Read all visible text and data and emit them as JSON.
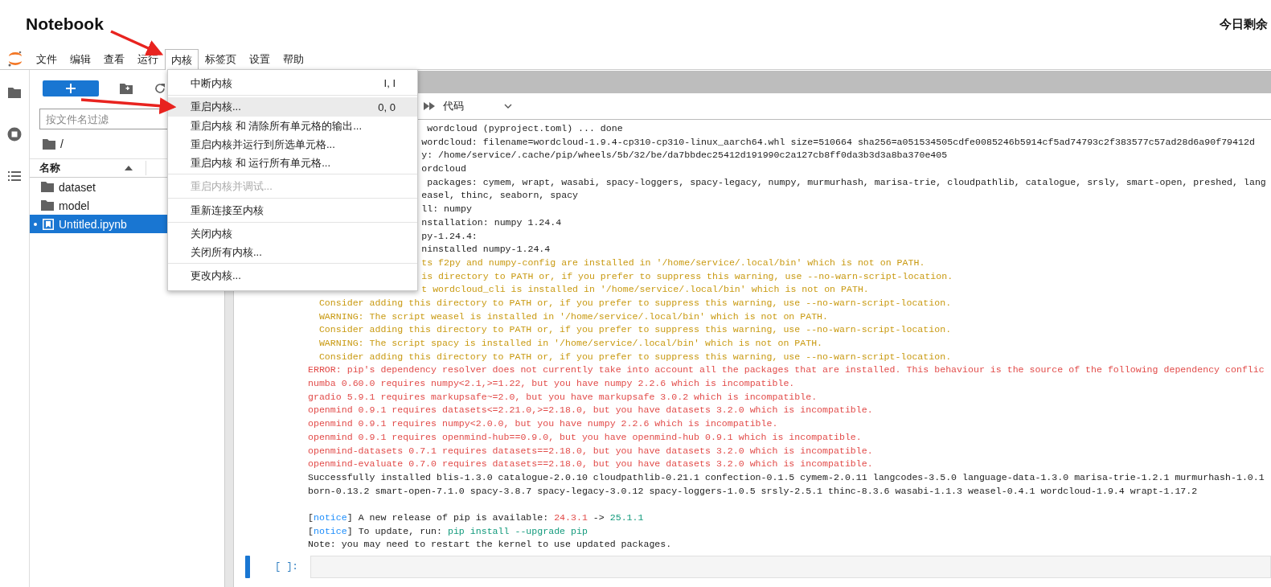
{
  "header": {
    "title": "Notebook",
    "quota_text": "今日剩余"
  },
  "menubar": {
    "items": [
      {
        "label": "文件",
        "selected": false
      },
      {
        "label": "编辑",
        "selected": false
      },
      {
        "label": "查看",
        "selected": false
      },
      {
        "label": "运行",
        "selected": false
      },
      {
        "label": "内核",
        "selected": true
      },
      {
        "label": "标签页",
        "selected": false
      },
      {
        "label": "设置",
        "selected": false
      },
      {
        "label": "帮助",
        "selected": false
      }
    ]
  },
  "kernel_menu": {
    "groups": [
      [
        {
          "label": "中断内核",
          "shortcut": "I, I",
          "highlighted": false,
          "disabled": false
        }
      ],
      [
        {
          "label": "重启内核...",
          "shortcut": "0, 0",
          "highlighted": true,
          "disabled": false
        },
        {
          "label": "重启内核 和 清除所有单元格的输出...",
          "highlighted": false,
          "disabled": false
        },
        {
          "label": "重启内核并运行到所选单元格...",
          "highlighted": false,
          "disabled": false
        },
        {
          "label": "重启内核 和 运行所有单元格...",
          "highlighted": false,
          "disabled": false
        }
      ],
      [
        {
          "label": "重启内核并调试...",
          "highlighted": false,
          "disabled": true
        }
      ],
      [
        {
          "label": "重新连接至内核",
          "highlighted": false,
          "disabled": false
        }
      ],
      [
        {
          "label": "关闭内核",
          "highlighted": false,
          "disabled": false
        },
        {
          "label": "关闭所有内核...",
          "highlighted": false,
          "disabled": false
        }
      ],
      [
        {
          "label": "更改内核...",
          "highlighted": false,
          "disabled": false
        }
      ]
    ]
  },
  "file_browser": {
    "filter_placeholder": "按文件名过滤",
    "path": "/",
    "column": "名称",
    "files": [
      {
        "name": "dataset",
        "kind": "folder",
        "selected": false,
        "running": false
      },
      {
        "name": "model",
        "kind": "folder",
        "selected": false,
        "running": false
      },
      {
        "name": "Untitled.ipynb",
        "kind": "notebook",
        "selected": true,
        "running": true
      }
    ]
  },
  "notebook": {
    "cell_type": "代码",
    "prompt": "[ ]:",
    "output": [
      {
        "kind": "plain",
        "covered": true,
        "text": " wordcloud (pyproject.toml) ... done"
      },
      {
        "kind": "plain",
        "covered": true,
        "text": "wordcloud: filename=wordcloud-1.9.4-cp310-cp310-linux_aarch64.whl size=510664 sha256=a051534505cdfe0085246b5914cf5ad74793c2f383577c57ad28d6a90f79412d"
      },
      {
        "kind": "plain",
        "covered": true,
        "text": "y: /home/service/.cache/pip/wheels/5b/32/be/da7bbdec25412d191990c2a127cb8ff0da3b3d3a8ba370e405"
      },
      {
        "kind": "plain",
        "covered": true,
        "text": "ordcloud"
      },
      {
        "kind": "plain",
        "covered": true,
        "text": " packages: cymem, wrapt, wasabi, spacy-loggers, spacy-legacy, numpy, murmurhash, marisa-trie, cloudpathlib, catalogue, srsly, smart-open, preshed, lang"
      },
      {
        "kind": "plain",
        "covered": true,
        "text": "easel, thinc, seaborn, spacy"
      },
      {
        "kind": "plain",
        "covered": true,
        "text": "ll: numpy"
      },
      {
        "kind": "plain",
        "covered": true,
        "text": "nstallation: numpy 1.24.4"
      },
      {
        "kind": "plain",
        "covered": true,
        "text": "py-1.24.4:"
      },
      {
        "kind": "plain",
        "covered": true,
        "text": "ninstalled numpy-1.24.4"
      },
      {
        "kind": "warning",
        "covered": true,
        "text": "ts f2py and numpy-config are installed in '/home/service/.local/bin' which is not on PATH."
      },
      {
        "kind": "warning",
        "covered": true,
        "text": "is directory to PATH or, if you prefer to suppress this warning, use --no-warn-script-location."
      },
      {
        "kind": "warning",
        "covered": true,
        "text": "t wordcloud_cli is installed in '/home/service/.local/bin' which is not on PATH."
      },
      {
        "kind": "warning",
        "covered": false,
        "text": "  Consider adding this directory to PATH or, if you prefer to suppress this warning, use --no-warn-script-location."
      },
      {
        "kind": "warning",
        "covered": false,
        "text": "  WARNING: The script weasel is installed in '/home/service/.local/bin' which is not on PATH."
      },
      {
        "kind": "warning",
        "covered": false,
        "text": "  Consider adding this directory to PATH or, if you prefer to suppress this warning, use --no-warn-script-location."
      },
      {
        "kind": "warning",
        "covered": false,
        "text": "  WARNING: The script spacy is installed in '/home/service/.local/bin' which is not on PATH."
      },
      {
        "kind": "warning",
        "covered": false,
        "text": "  Consider adding this directory to PATH or, if you prefer to suppress this warning, use --no-warn-script-location."
      },
      {
        "kind": "error",
        "covered": false,
        "text": "ERROR: pip's dependency resolver does not currently take into account all the packages that are installed. This behaviour is the source of the following dependency conflic"
      },
      {
        "kind": "error",
        "covered": false,
        "text": "numba 0.60.0 requires numpy<2.1,>=1.22, but you have numpy 2.2.6 which is incompatible."
      },
      {
        "kind": "error",
        "covered": false,
        "text": "gradio 5.9.1 requires markupsafe~=2.0, but you have markupsafe 3.0.2 which is incompatible."
      },
      {
        "kind": "error",
        "covered": false,
        "text": "openmind 0.9.1 requires datasets<=2.21.0,>=2.18.0, but you have datasets 3.2.0 which is incompatible."
      },
      {
        "kind": "error",
        "covered": false,
        "text": "openmind 0.9.1 requires numpy<2.0.0, but you have numpy 2.2.6 which is incompatible."
      },
      {
        "kind": "error",
        "covered": false,
        "text": "openmind 0.9.1 requires openmind-hub==0.9.0, but you have openmind-hub 0.9.1 which is incompatible."
      },
      {
        "kind": "error",
        "covered": false,
        "text": "openmind-datasets 0.7.1 requires datasets==2.18.0, but you have datasets 3.2.0 which is incompatible."
      },
      {
        "kind": "error",
        "covered": false,
        "text": "openmind-evaluate 0.7.0 requires datasets==2.18.0, but you have datasets 3.2.0 which is incompatible."
      },
      {
        "kind": "plain",
        "covered": false,
        "text": "Successfully installed blis-1.3.0 catalogue-2.0.10 cloudpathlib-0.21.1 confection-0.1.5 cymem-2.0.11 langcodes-3.5.0 language-data-1.3.0 marisa-trie-1.2.1 murmurhash-1.0.1"
      },
      {
        "kind": "plain",
        "covered": false,
        "text": "born-0.13.2 smart-open-7.1.0 spacy-3.8.7 spacy-legacy-3.0.12 spacy-loggers-1.0.5 srsly-2.5.1 thinc-8.3.6 wasabi-1.1.3 weasel-0.4.1 wordcloud-1.9.4 wrapt-1.17.2"
      },
      {
        "kind": "blank"
      },
      {
        "kind": "segmented",
        "segments": [
          {
            "kind": "plain",
            "text": "["
          },
          {
            "kind": "notice",
            "text": "notice"
          },
          {
            "kind": "plain",
            "text": "] A new release of pip is available: "
          },
          {
            "kind": "old",
            "text": "24.3.1"
          },
          {
            "kind": "plain",
            "text": " -> "
          },
          {
            "kind": "new",
            "text": "25.1.1"
          }
        ]
      },
      {
        "kind": "segmented",
        "segments": [
          {
            "kind": "plain",
            "text": "["
          },
          {
            "kind": "notice",
            "text": "notice"
          },
          {
            "kind": "plain",
            "text": "] To update, run: "
          },
          {
            "kind": "new",
            "text": "pip install --upgrade pip"
          }
        ]
      },
      {
        "kind": "plain",
        "covered": false,
        "text": "Note: you may need to restart the kernel to use updated packages."
      }
    ]
  }
}
